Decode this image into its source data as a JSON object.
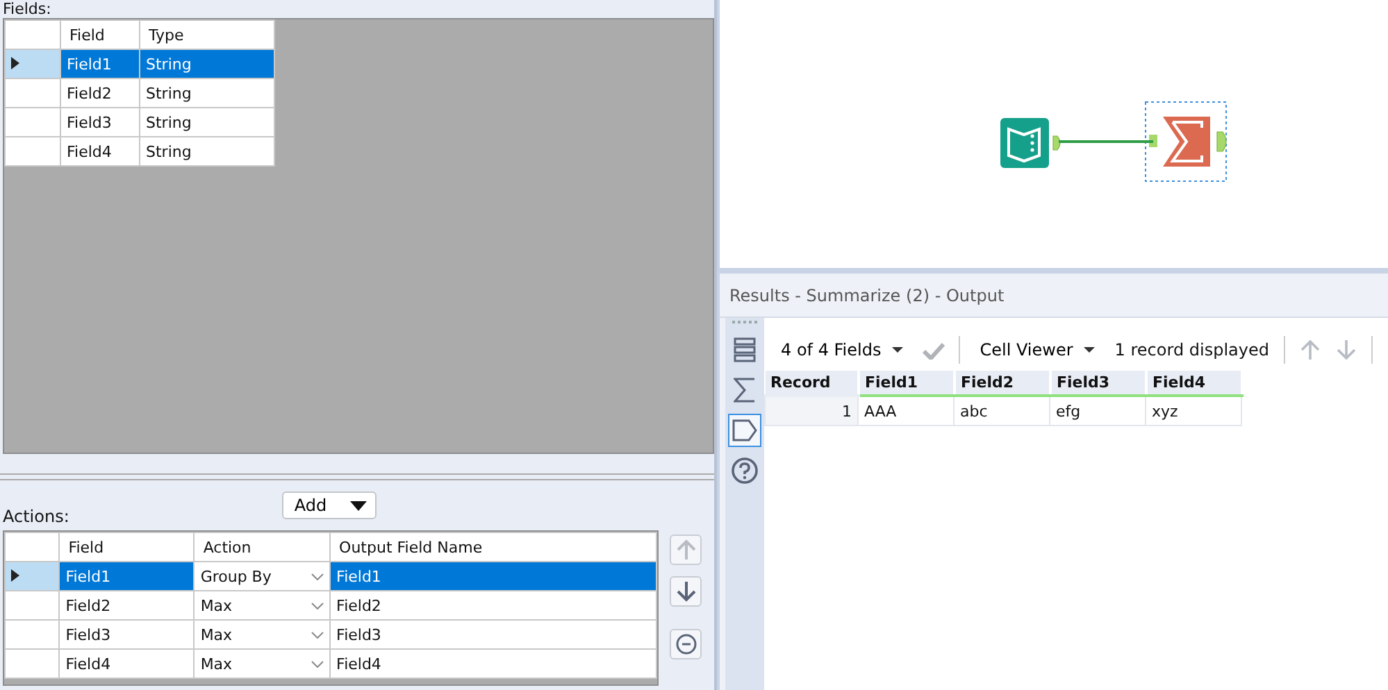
{
  "fields_panel": {
    "label": "Fields:",
    "columns": [
      "Field",
      "Type"
    ],
    "rows": [
      {
        "cells": [
          "Field1",
          "String"
        ],
        "selected": true
      },
      {
        "cells": [
          "Field2",
          "String"
        ],
        "selected": false
      },
      {
        "cells": [
          "Field3",
          "String"
        ],
        "selected": false
      },
      {
        "cells": [
          "Field4",
          "String"
        ],
        "selected": false
      }
    ]
  },
  "actions_panel": {
    "label": "Actions:",
    "add_button": "Add",
    "columns": [
      "Field",
      "Action",
      "Output Field Name"
    ],
    "rows": [
      {
        "field": "Field1",
        "action": "Group By",
        "output": "Field1",
        "selected": true
      },
      {
        "field": "Field2",
        "action": "Max",
        "output": "Field2",
        "selected": false
      },
      {
        "field": "Field3",
        "action": "Max",
        "output": "Field3",
        "selected": false
      },
      {
        "field": "Field4",
        "action": "Max",
        "output": "Field4",
        "selected": false
      }
    ]
  },
  "canvas": {
    "nodes": [
      {
        "kind": "input",
        "selected": false
      },
      {
        "kind": "summarize",
        "selected": true
      }
    ]
  },
  "results": {
    "title": "Results - Summarize (2) - Output",
    "side_tabs": [
      {
        "kind": "grid",
        "selected": false
      },
      {
        "kind": "sum",
        "selected": false
      },
      {
        "kind": "tag",
        "selected": true
      },
      {
        "kind": "help",
        "selected": false
      }
    ],
    "fields_selector": "4 of 4 Fields",
    "viewer_selector": "Cell Viewer",
    "record_count": "1 record displayed",
    "columns": [
      "Record",
      "Field1",
      "Field2",
      "Field3",
      "Field4"
    ],
    "rows": [
      [
        "1",
        "AAA",
        "abc",
        "efg",
        "xyz"
      ]
    ]
  }
}
